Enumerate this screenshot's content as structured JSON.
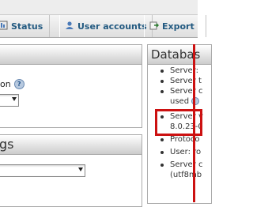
{
  "tabs": [
    {
      "label": "Status",
      "icon": "status-icon"
    },
    {
      "label": "User accounts",
      "icon": "user-accounts-icon"
    },
    {
      "label": "Export",
      "icon": "export-icon"
    }
  ],
  "left_panels": {
    "panel1": {
      "title": "",
      "field_label": "on",
      "help_icon": "help-icon"
    },
    "panel2": {
      "title": "gs"
    }
  },
  "database_server": {
    "title": "Databas",
    "items": [
      {
        "text": "Server:",
        "continued": false
      },
      {
        "text": "Server t",
        "continued": false
      },
      {
        "text": "Server c",
        "continued": false
      },
      {
        "text": "used",
        "continued": true
      },
      {
        "text": "Server v",
        "continued": false
      },
      {
        "text": "8.0.23-0",
        "continued": true
      },
      {
        "text": "Protoco",
        "continued": false
      },
      {
        "text": "User: ro",
        "continued": false
      },
      {
        "text": "Server c",
        "continued": false
      },
      {
        "text": "(utf8mb",
        "continued": true
      }
    ]
  },
  "colors": {
    "tab_text": "#235a81",
    "highlight": "#cc1111"
  }
}
